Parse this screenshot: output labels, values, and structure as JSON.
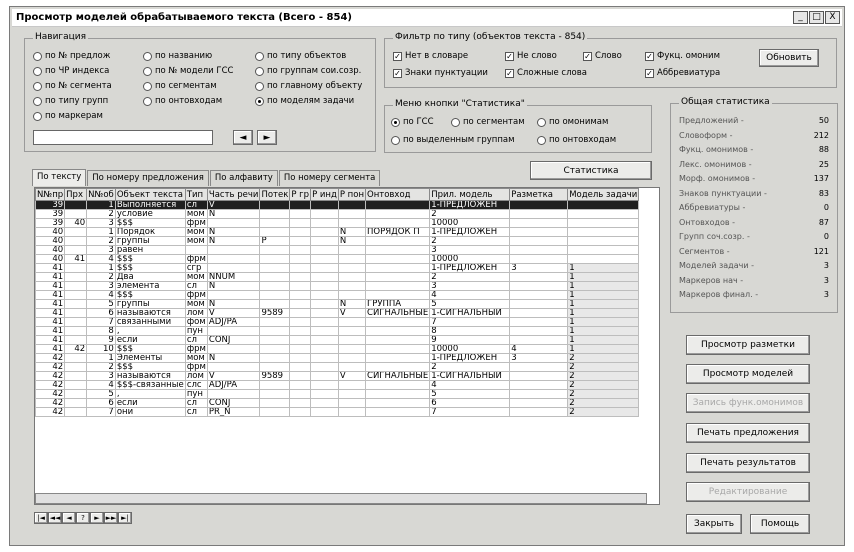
{
  "window": {
    "title": "Просмотр моделей обрабатываемого текста (Всего - 854)",
    "minimize": "_",
    "maximize": "□",
    "close": "X"
  },
  "nav": {
    "legend": "Навигация",
    "options": [
      {
        "label": "по № предлож",
        "selected": false
      },
      {
        "label": "по названию",
        "selected": false
      },
      {
        "label": "по типу объектов",
        "selected": false
      },
      {
        "label": "по ЧР индекса",
        "selected": false
      },
      {
        "label": "по № модели ГСС",
        "selected": false
      },
      {
        "label": "по группам сои.созр.",
        "selected": false
      },
      {
        "label": "по № сегмента",
        "selected": false
      },
      {
        "label": "по сегментам",
        "selected": false
      },
      {
        "label": "по главному объекту",
        "selected": false
      },
      {
        "label": "по типу групп",
        "selected": false
      },
      {
        "label": "по онтовходам",
        "selected": false
      },
      {
        "label": "по моделям задачи",
        "selected": true
      },
      {
        "label": "по маркерам",
        "selected": false
      }
    ],
    "search_value": "",
    "prev": "◄",
    "next": "►"
  },
  "filter": {
    "legend": "Фильтр по типу (объектов текста - 854)",
    "items": [
      {
        "label": "Нет в словаре",
        "checked": true
      },
      {
        "label": "Не слово",
        "checked": true
      },
      {
        "label": "Слово",
        "checked": true
      },
      {
        "label": "Фукц. омоним",
        "checked": true
      },
      {
        "label": "Знаки пунктуации",
        "checked": true
      },
      {
        "label": "Сложные слова",
        "checked": true
      },
      {
        "label": "Аббревиатура",
        "checked": true
      }
    ],
    "refresh": "Обновить"
  },
  "statmenu": {
    "legend": "Меню кнопки \"Статистика\"",
    "options": [
      {
        "label": "по ГСС",
        "selected": true
      },
      {
        "label": "по сегментам",
        "selected": false
      },
      {
        "label": "по омонимам",
        "selected": false
      },
      {
        "label": "по выделенным группам",
        "selected": false
      },
      {
        "label": "по онтовходам",
        "selected": false
      }
    ]
  },
  "stats_button": "Статистика",
  "general": {
    "legend": "Общая статистика",
    "rows": [
      {
        "label": "Предложений -",
        "value": "50"
      },
      {
        "label": "Словоформ -",
        "value": "212"
      },
      {
        "label": "Фукц. омонимов -",
        "value": "88"
      },
      {
        "label": "Лекс. омонимов -",
        "value": "25"
      },
      {
        "label": "Морф. омонимов -",
        "value": "137"
      },
      {
        "label": "Знаков пунктуации -",
        "value": "83"
      },
      {
        "label": "Аббревиатуры -",
        "value": "0"
      },
      {
        "label": "Онтовходов -",
        "value": "87"
      },
      {
        "label": "Групп соч.созр. -",
        "value": "0"
      },
      {
        "label": "Сегментов -",
        "value": "121"
      },
      {
        "label": "Моделей задачи -",
        "value": "3"
      },
      {
        "label": "Маркеров нач -",
        "value": "3"
      },
      {
        "label": "Маркеров финал. -",
        "value": "3"
      }
    ]
  },
  "tabs": [
    "По тексту",
    "По номеру предложения",
    "По алфавиту",
    "По номеру сегмента"
  ],
  "table": {
    "headers": [
      "N№пр",
      "Прх",
      "N№об",
      "Объект текста",
      "Тип",
      "Часть речи",
      "Потек",
      "Р гр",
      "Р инд",
      "Р пон",
      "Онтовход",
      "Прил. модель",
      "Разметка",
      "Модель задачи"
    ],
    "rows": [
      [
        "39",
        "",
        "1",
        "Выполняется",
        "сл",
        "V",
        "",
        "",
        "",
        "",
        "",
        "1-ПРЕДЛОЖЕН",
        "",
        ""
      ],
      [
        "39",
        "",
        "2",
        "условие",
        "мом",
        "N",
        "",
        "",
        "",
        "",
        "",
        "2",
        "",
        ""
      ],
      [
        "39",
        "40",
        "3",
        "$$$",
        "фрм",
        "",
        "",
        "",
        "",
        "",
        "",
        "10000",
        "",
        ""
      ],
      [
        "40",
        "",
        "1",
        "Порядок",
        "мом",
        "N",
        "",
        "",
        "",
        "N",
        "ПОРЯДОК П",
        "1-ПРЕДЛОЖЕН",
        "",
        ""
      ],
      [
        "40",
        "",
        "2",
        "группы",
        "мом",
        "N",
        "P",
        "",
        "",
        "N",
        "",
        "2",
        "",
        ""
      ],
      [
        "40",
        "",
        "3",
        "равен",
        "",
        "",
        "",
        "",
        "",
        "",
        "",
        "3",
        "",
        ""
      ],
      [
        "40",
        "41",
        "4",
        "$$$",
        "фрм",
        "",
        "",
        "",
        "",
        "",
        "",
        "10000",
        "",
        ""
      ],
      [
        "41",
        "",
        "1",
        "$$$",
        "сгр",
        "",
        "",
        "",
        "",
        "",
        "",
        "1-ПРЕДЛОЖЕН",
        "3",
        "1"
      ],
      [
        "41",
        "",
        "2",
        "Два",
        "мом",
        "NNUM",
        "",
        "",
        "",
        "",
        "",
        "2",
        "",
        "1"
      ],
      [
        "41",
        "",
        "3",
        "элемента",
        "сл",
        "N",
        "",
        "",
        "",
        "",
        "",
        "3",
        "",
        "1"
      ],
      [
        "41",
        "",
        "4",
        "$$$",
        "фрм",
        "",
        "",
        "",
        "",
        "",
        "",
        "4",
        "",
        "1"
      ],
      [
        "41",
        "",
        "5",
        "группы",
        "мом",
        "N",
        "",
        "",
        "",
        "N",
        "ГРУППА",
        "5",
        "",
        "1"
      ],
      [
        "41",
        "",
        "6",
        "называются",
        "лом",
        "V",
        "9589",
        "",
        "",
        "V",
        "СИГНАЛЬНЫЕ",
        "1-СИГНАЛЬНЫЙ",
        "",
        "1"
      ],
      [
        "41",
        "",
        "7",
        "связанными",
        "фом",
        "ADJ/PA",
        "",
        "",
        "",
        "",
        "",
        "7",
        "",
        "1"
      ],
      [
        "41",
        "",
        "8",
        ",",
        "пун",
        "",
        "",
        "",
        "",
        "",
        "",
        "8",
        "",
        "1"
      ],
      [
        "41",
        "",
        "9",
        "если",
        "сл",
        "CONJ",
        "",
        "",
        "",
        "",
        "",
        "9",
        "",
        "1"
      ],
      [
        "41",
        "42",
        "10",
        "$$$",
        "фрм",
        "",
        "",
        "",
        "",
        "",
        "",
        "10000",
        "4",
        "1"
      ],
      [
        "42",
        "",
        "1",
        "Элементы",
        "мом",
        "N",
        "",
        "",
        "",
        "",
        "",
        "1-ПРЕДЛОЖЕН",
        "3",
        "2"
      ],
      [
        "42",
        "",
        "2",
        "$$$",
        "фрм",
        "",
        "",
        "",
        "",
        "",
        "",
        "2",
        "",
        "2"
      ],
      [
        "42",
        "",
        "3",
        "называются",
        "лом",
        "V",
        "9589",
        "",
        "",
        "V",
        "СИГНАЛЬНЫЕ",
        "1-СИГНАЛЬНЫЙ",
        "",
        "2"
      ],
      [
        "42",
        "",
        "4",
        "$$$-связанные",
        "слс",
        "ADJ/PA",
        "",
        "",
        "",
        "",
        "",
        "4",
        "",
        "2"
      ],
      [
        "42",
        "",
        "5",
        ",",
        "пун",
        "",
        "",
        "",
        "",
        "",
        "",
        "5",
        "",
        "2"
      ],
      [
        "42",
        "",
        "6",
        "если",
        "сл",
        "CONJ",
        "",
        "",
        "",
        "",
        "",
        "6",
        "",
        "2"
      ],
      [
        "42",
        "",
        "7",
        "они",
        "сл",
        "PR_N",
        "",
        "",
        "",
        "",
        "",
        "7",
        "",
        "2"
      ]
    ]
  },
  "pager": {
    "buttons": [
      "|◄",
      "◄◄",
      "◄",
      "?",
      "►",
      "►►",
      "►|"
    ]
  },
  "buttons": {
    "view_markup": "Просмотр разметки",
    "view_models": "Просмотр моделей",
    "save_func": "Запись функ.омонимов",
    "print_sentences": "Печать предложения",
    "print_results": "Печать результатов",
    "edit": "Редактирование",
    "close": "Закрыть",
    "help": "Помощь"
  }
}
